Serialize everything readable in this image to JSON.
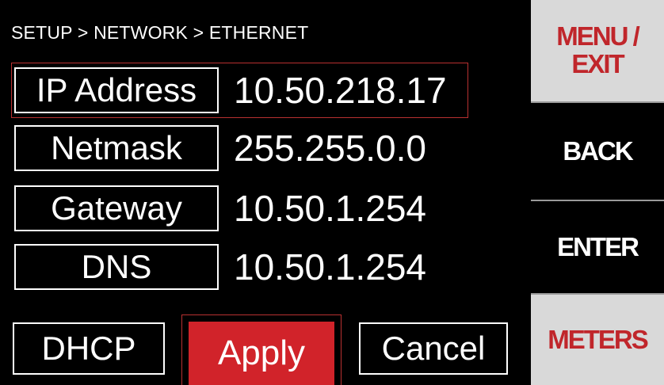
{
  "breadcrumb": "SETUP > NETWORK > ETHERNET",
  "fields": [
    {
      "label": "IP Address",
      "value": "10.50.218.17",
      "selected": true
    },
    {
      "label": "Netmask",
      "value": "255.255.0.0",
      "selected": false
    },
    {
      "label": "Gateway",
      "value": "10.50.1.254",
      "selected": false
    },
    {
      "label": "DNS",
      "value": "10.50.1.254",
      "selected": false
    }
  ],
  "buttons": {
    "dhcp": "DHCP",
    "apply": "Apply",
    "cancel": "Cancel"
  },
  "side": {
    "menu_exit_line1": "MENU /",
    "menu_exit_line2": "EXIT",
    "back": "BACK",
    "enter": "ENTER",
    "meters": "METERS"
  },
  "colors": {
    "background": "#000000",
    "accent_red": "#d1232a",
    "side_text_red": "#c0262b",
    "side_light_bg": "#d9d9d9",
    "selection_outline": "#b83030"
  }
}
